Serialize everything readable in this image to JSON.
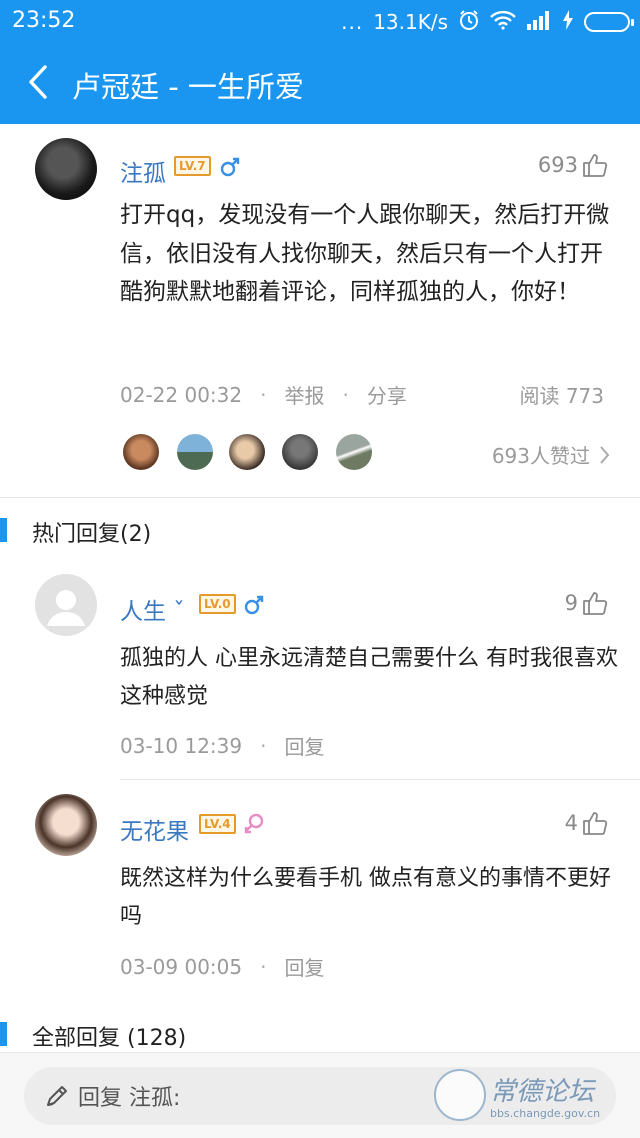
{
  "status_bar": {
    "time": "23:52",
    "dots": "...",
    "speed": "13.1K/s"
  },
  "header": {
    "title": "卢冠廷 - 一生所爱"
  },
  "post": {
    "username": "注孤",
    "level": "LV.7",
    "gender": "male",
    "likes": "693",
    "text": "打开qq，发现没有一个人跟你聊天，然后打开微信，依旧没有人找你聊天，然后只有一个人打开酷狗默默地翻着评论，同样孤独的人，你好！",
    "date": "02-22 00:32",
    "report_label": "举报",
    "share_label": "分享",
    "reads": "阅读 773",
    "like_summary": "693人赞过"
  },
  "hot_replies": {
    "title": "热门回复(2)",
    "items": [
      {
        "username": "人生 ˇ",
        "level": "LV.0",
        "gender": "male",
        "likes": "9",
        "text": "孤独的人 心里永远清楚自己需要什么   有时我很喜欢这种感觉",
        "date": "03-10 12:39",
        "reply_label": "回复"
      },
      {
        "username": "无花果",
        "level": "LV.4",
        "gender": "female",
        "likes": "4",
        "text": "既然这样为什么要看手机 做点有意义的事情不更好吗",
        "date": "03-09 00:05",
        "reply_label": "回复"
      }
    ]
  },
  "all_replies": {
    "title": "全部回复 (128)"
  },
  "reply_box": {
    "placeholder": "回复 注孤:"
  },
  "watermark": {
    "text": "常德论坛",
    "url": "bbs.changde.gov.cn"
  },
  "colors": {
    "header": "#1a96f0",
    "username": "#3a78c2",
    "level": "#e69a2e",
    "male": "#3a8fe6",
    "female": "#e98bc4"
  }
}
